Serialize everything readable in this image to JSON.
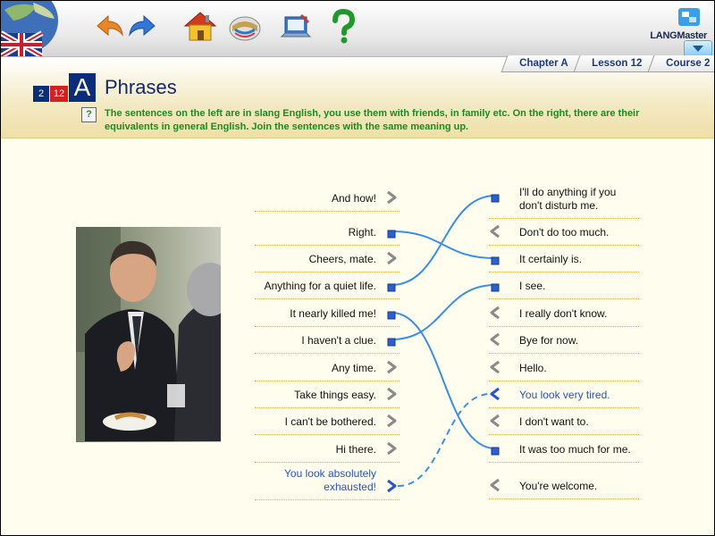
{
  "toolbar": {
    "buttons": [
      "back-icon",
      "forward-icon",
      "home-icon",
      "dictionary-icon",
      "notebook-icon",
      "help-icon"
    ],
    "brand": "LANGMaster"
  },
  "tabs": [
    {
      "label": "Chapter A"
    },
    {
      "label": "Lesson 12"
    },
    {
      "label": "Course 2"
    }
  ],
  "header": {
    "badge": {
      "n1": "2",
      "n2": "12",
      "letter": "A"
    },
    "title": "Phrases",
    "help": "?",
    "instructions": "The sentences on the left are in slang English, you use them with friends, in family etc. On the right, there are their equivalents in general English. Join the sentences with the same meaning up."
  },
  "left_items": [
    {
      "text": "And how!",
      "state": "arrow"
    },
    {
      "text": "Right.",
      "state": "connected"
    },
    {
      "text": "Cheers, mate.",
      "state": "arrow"
    },
    {
      "text": "Anything for a quiet life.",
      "state": "connected"
    },
    {
      "text": "It nearly killed me!",
      "state": "connected"
    },
    {
      "text": "I haven't a clue.",
      "state": "connected"
    },
    {
      "text": "Any time.",
      "state": "arrow"
    },
    {
      "text": "Take things easy.",
      "state": "arrow"
    },
    {
      "text": "I can't be bothered.",
      "state": "arrow"
    },
    {
      "text": "Hi there.",
      "state": "arrow"
    },
    {
      "text": "You look absolutely exhausted!",
      "state": "active"
    }
  ],
  "right_items": [
    {
      "text": "I'll do anything if you don't disturb me.",
      "state": "connected"
    },
    {
      "text": "Don't do too much.",
      "state": "arrow"
    },
    {
      "text": "It certainly is.",
      "state": "connected"
    },
    {
      "text": "I see.",
      "state": "connected"
    },
    {
      "text": "I really don't know.",
      "state": "arrow"
    },
    {
      "text": "Bye for now.",
      "state": "arrow"
    },
    {
      "text": "Hello.",
      "state": "arrow"
    },
    {
      "text": "You look very tired.",
      "state": "active"
    },
    {
      "text": "I don't want to.",
      "state": "arrow"
    },
    {
      "text": "It was too much for me.",
      "state": "connected"
    },
    {
      "text": "You're welcome.",
      "state": "arrow"
    }
  ],
  "connections": [
    {
      "from": 1,
      "to": 2,
      "style": "solid"
    },
    {
      "from": 3,
      "to": 0,
      "style": "solid"
    },
    {
      "from": 4,
      "to": 9,
      "style": "solid"
    },
    {
      "from": 5,
      "to": 3,
      "style": "solid"
    },
    {
      "from": 10,
      "to": 7,
      "style": "dashed"
    }
  ],
  "colors": {
    "link": "#3a8ee8",
    "active_text": "#2a54b4",
    "instructions": "#1e8a1e",
    "title": "#0f2a6a",
    "dotted": "#e3b24a"
  }
}
